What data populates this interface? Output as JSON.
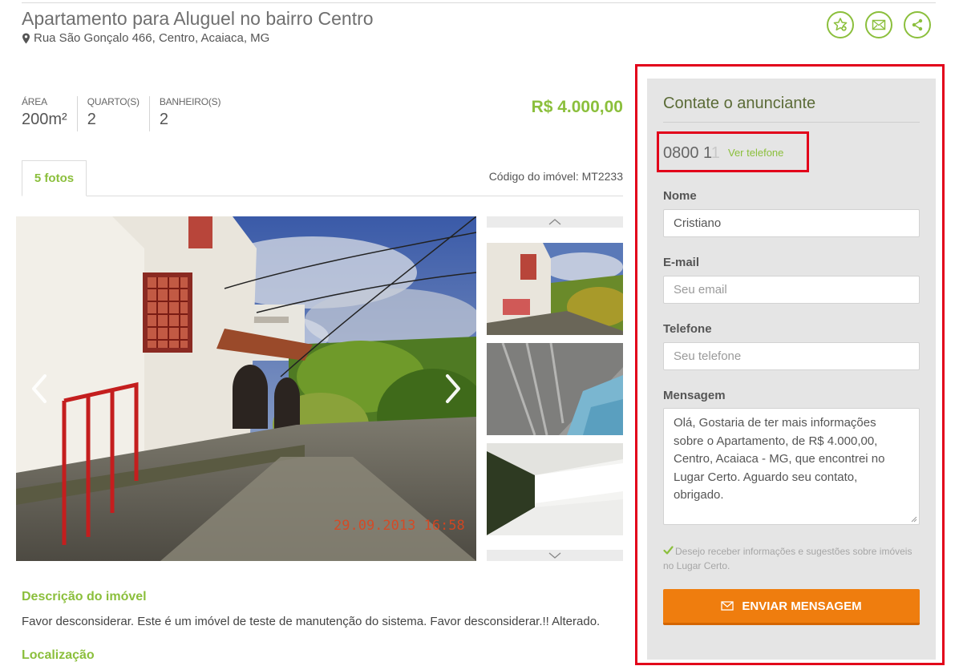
{
  "listing": {
    "title": "Apartamento para Aluguel no bairro Centro",
    "address": "Rua São Gonçalo 466, Centro, Acaiaca, MG",
    "price": "R$ 4.000,00",
    "code_label": "Código do imóvel: MT2233",
    "specs": [
      {
        "label": "ÁREA",
        "value": "200m²"
      },
      {
        "label": "QUARTO(S)",
        "value": "2"
      },
      {
        "label": "BANHEIRO(S)",
        "value": "2"
      }
    ]
  },
  "actions": {
    "icons": [
      "favorite-star-icon",
      "email-icon",
      "share-icon"
    ]
  },
  "gallery": {
    "tab_label": "5 fotos",
    "photo_timestamp": "29.09.2013 16:58",
    "icons": [
      "chevron-left-icon",
      "chevron-right-icon",
      "chevron-up-icon",
      "chevron-down-icon"
    ]
  },
  "description": {
    "title": "Descrição do imóvel",
    "text": "Favor desconsiderar. Este é um imóvel de teste de manutenção do sistema. Favor desconsiderar.!! Alterado."
  },
  "location": {
    "title": "Localização"
  },
  "contact": {
    "title": "Contate o anunciante",
    "phone_partial": "0800 1",
    "phone_faded": "1",
    "phone_link": "Ver telefone",
    "name_label": "Nome",
    "name_value": "Cristiano",
    "email_label": "E-mail",
    "email_placeholder": "Seu email",
    "phone_label": "Telefone",
    "phone_placeholder": "Seu telefone",
    "message_label": "Mensagem",
    "message_value": "Olá, Gostaria de ter mais informações sobre o Apartamento, de R$ 4.000,00, Centro, Acaiaca - MG, que encontrei no Lugar Certo. Aguardo seu contato, obrigado.",
    "consent_text": "Desejo receber informações e sugestões sobre imóveis no Lugar Certo.",
    "consent_checked": true,
    "send_label": "ENVIAR MENSAGEM"
  },
  "colors": {
    "accent_green": "#8bbf3c",
    "button_orange": "#ef7d0e",
    "highlight_red": "#e2001a",
    "panel_gray": "#e5e5e5"
  }
}
